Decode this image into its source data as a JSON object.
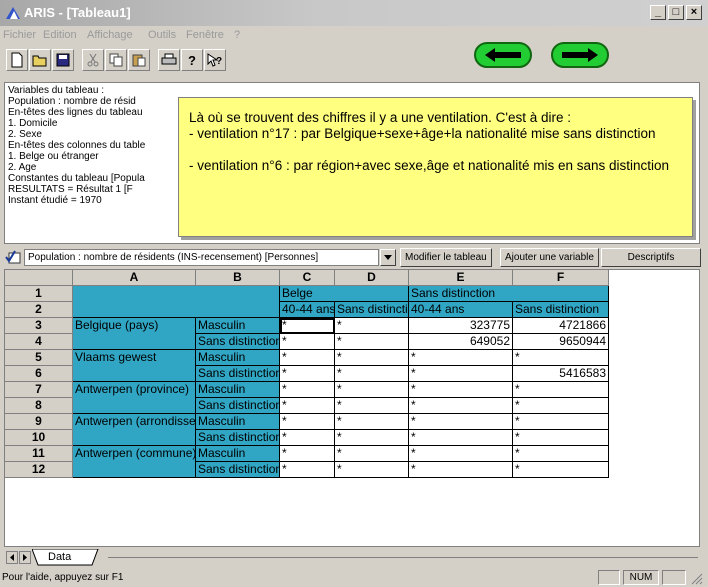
{
  "window": {
    "title": "ARIS - [Tableau1]",
    "min": "_",
    "max": "□",
    "close": "×"
  },
  "menu": [
    "Fichier",
    "Edition",
    "Affichage",
    "Outils",
    "Fenêtre",
    "?"
  ],
  "info_lines": [
    "Variables du tableau :",
    "   Population : nombre de résid",
    "En-têtes des lignes du tableau",
    "   1. Domicile",
    "   2. Sexe",
    "En-têtes des colonnes du table",
    "   1. Belge ou étranger",
    "   2. Age",
    "Constantes du tableau [Popula",
    "   RESULTATS = Résultat 1 [F",
    "   Instant étudié = 1970"
  ],
  "tooltip": {
    "line1": "Là où se trouvent des chiffres il y a une ventilation. C'est à dire :",
    "line2": "- ventilation n°17 : par Belgique+sexe+âge+la nationalité mise sans distinction",
    "line3": "- ventilation n°6 : par région+avec sexe,âge et nationalité mis en sans distinction"
  },
  "gridbar": {
    "combo_value": "Population : nombre de résidents (INS-recensement) [Personnes]",
    "modify": "Modifier le tableau",
    "add_var": "Ajouter une variable",
    "descriptifs": "Descriptifs"
  },
  "grid": {
    "columns": [
      "A",
      "B",
      "C",
      "D",
      "E",
      "F"
    ],
    "rows": [
      "1",
      "2",
      "3",
      "4",
      "5",
      "6",
      "7",
      "8",
      "9",
      "10",
      "11",
      "12"
    ],
    "header_belge": "Belge",
    "header_sans_top": "Sans distinction",
    "h_c2": "40-44 ans",
    "h_d2": "Sans distinction",
    "h_e2": "40-44 ans",
    "h_f2": "Sans distinction",
    "row_labels": [
      "Belgique (pays)",
      "Vlaams gewest",
      "Antwerpen (province)",
      "Antwerpen (arrondissement)",
      "Antwerpen (commune)"
    ],
    "sex_m": "Masculin",
    "sex_sd": "Sans distinction",
    "star": "*",
    "e3": "323775",
    "f3": "4721866",
    "e4": "649052",
    "f4": "9650944",
    "f6": "5416583"
  },
  "sheet_tab": "Data",
  "status": {
    "help": "Pour l'aide, appuyez sur F1",
    "num": "NUM"
  }
}
